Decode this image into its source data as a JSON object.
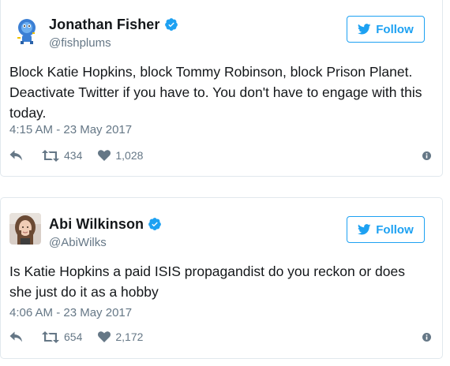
{
  "tweets": [
    {
      "display_name": "Jonathan Fisher",
      "handle": "@fishplums",
      "follow_label": "Follow",
      "text": "Block Katie Hopkins, block Tommy Robinson, block Prison Planet.\nDeactivate Twitter if you have to. You don't have to engage with this\ntoday.",
      "timestamp": "4:15 AM - 23 May 2017",
      "retweets": "434",
      "likes": "1,028",
      "avatar_icon": "cartoon-figure-avatar",
      "verified": true
    },
    {
      "display_name": "Abi Wilkinson",
      "handle": "@AbiWilks",
      "follow_label": "Follow",
      "text": "Is Katie Hopkins a paid ISIS propagandist do you reckon or does\nshe just do it as a hobby",
      "timestamp": "4:06 AM - 23 May 2017",
      "retweets": "654",
      "likes": "2,172",
      "avatar_icon": "photo-avatar",
      "verified": true
    }
  ],
  "colors": {
    "accent": "#1da1f2",
    "text": "#14171a",
    "muted": "#657786",
    "border": "#e1e8ed"
  }
}
